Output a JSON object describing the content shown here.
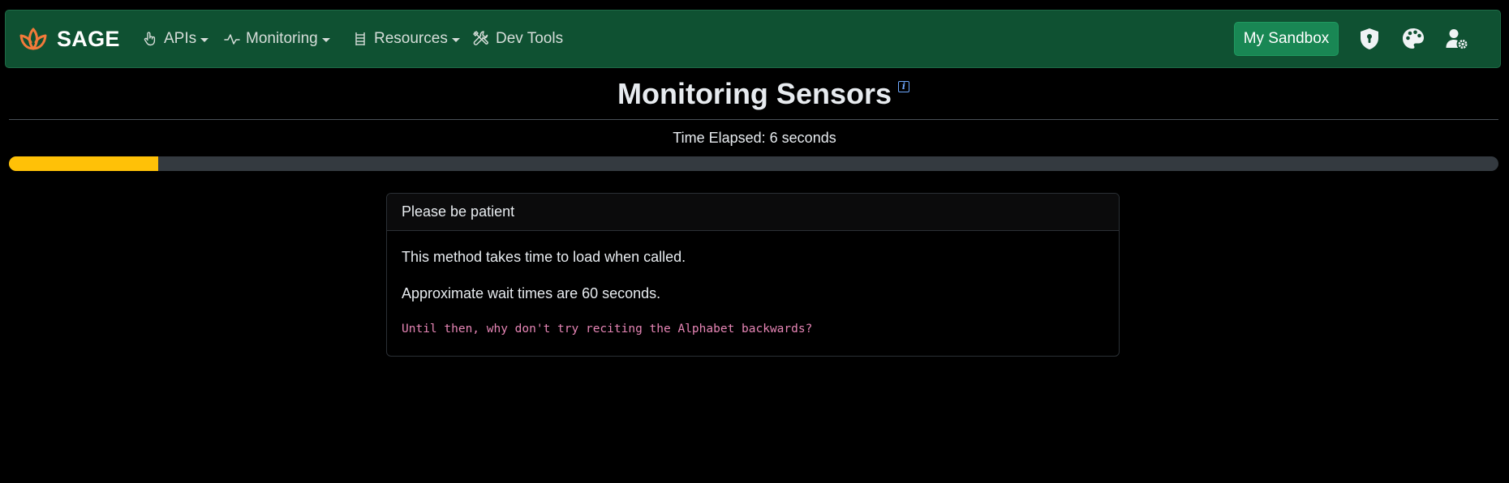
{
  "navbar": {
    "brand": "SAGE",
    "items": [
      {
        "label": "APIs",
        "icon": "hand-pointer-icon",
        "dropdown": true
      },
      {
        "label": "Monitoring",
        "icon": "activity-icon",
        "dropdown": true
      },
      {
        "label": "Resources",
        "icon": "ladder-icon",
        "dropdown": true
      },
      {
        "label": "Dev Tools",
        "icon": "tools-icon",
        "dropdown": false
      }
    ],
    "sandbox_button": "My Sandbox",
    "right_icons": [
      "shield-lock-icon",
      "palette-icon",
      "user-gear-icon"
    ],
    "colors": {
      "background": "#0f5132",
      "sandbox": "#198754",
      "brand_icon": "#f27a3a"
    }
  },
  "page": {
    "title": "Monitoring Sensors",
    "info_icon": "i",
    "elapsed": "Time Elapsed: 6 seconds",
    "progress_percent": 10,
    "progress_color": "#ffc107"
  },
  "card": {
    "header": "Please be patient",
    "line1": "This method takes time to load when called.",
    "line2": "Approximate wait times are 60 seconds.",
    "code": "Until then, why don't try reciting the Alphabet backwards?"
  }
}
